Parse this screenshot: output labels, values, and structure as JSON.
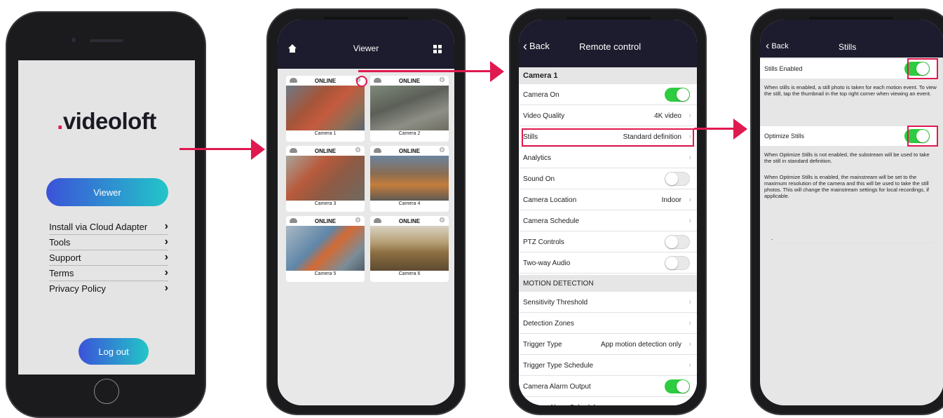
{
  "colors": {
    "accent_red": "#e0194f",
    "toggle_green": "#2ecc40",
    "nav_bar": "#1c1c2e",
    "viewer_gradient": [
      "#3b52d9",
      "#22c6c8"
    ]
  },
  "phone1": {
    "logo_text": "videoloft",
    "viewer_button": "Viewer",
    "menu": [
      {
        "label": "Install via Cloud Adapter",
        "chevron": "›"
      },
      {
        "label": "Tools",
        "chevron": "›"
      },
      {
        "label": "Support",
        "chevron": "›"
      },
      {
        "label": "Terms",
        "chevron": "›"
      },
      {
        "label": "Privacy Policy",
        "chevron": "›"
      }
    ],
    "logout_button": "Log out"
  },
  "phone2": {
    "title": "Viewer",
    "home_icon": "home-icon",
    "grid_icon": "grid-icon",
    "cameras": [
      {
        "status": "ONLINE",
        "name": "Camera 1"
      },
      {
        "status": "ONLINE",
        "name": "Camera 2"
      },
      {
        "status": "ONLINE",
        "name": "Camera 3"
      },
      {
        "status": "ONLINE",
        "name": "Camera 4"
      },
      {
        "status": "ONLINE",
        "name": "Camera 5"
      },
      {
        "status": "ONLINE",
        "name": "Camera 6"
      }
    ]
  },
  "phone3": {
    "back": "Back",
    "title": "Remote control",
    "camera_header": "Camera 1",
    "rows": [
      {
        "label": "Camera On",
        "toggle": true
      },
      {
        "label": "Video Quality",
        "value": "4K video"
      },
      {
        "label": "Stills",
        "value": "Standard definition"
      },
      {
        "label": "Analytics",
        "value": ""
      },
      {
        "label": "Sound On",
        "toggle": false
      },
      {
        "label": "Camera Location",
        "value": "Indoor"
      },
      {
        "label": "Camera Schedule",
        "value": ""
      },
      {
        "label": "PTZ Controls",
        "toggle": false
      },
      {
        "label": "Two-way Audio",
        "toggle": false
      }
    ],
    "motion_section": "MOTION DETECTION",
    "motion_rows": [
      {
        "label": "Sensitivity Threshold",
        "value": ""
      },
      {
        "label": "Detection Zones",
        "value": ""
      },
      {
        "label": "Trigger Type",
        "value": "App motion detection only"
      },
      {
        "label": "Trigger Type Schedule",
        "value": ""
      },
      {
        "label": "Camera Alarm Output",
        "toggle": true
      },
      {
        "label": "Camera Alarm Schedule",
        "value": ""
      }
    ]
  },
  "phone4": {
    "back": "Back",
    "title": "Stills",
    "stills_enabled_label": "Stills Enabled",
    "stills_enabled": true,
    "stills_enabled_desc": "When stills is enabled, a still photo is taken for each motion event. To view the still, tap the thumbnail in the top right corner when viewing an event.",
    "optimize_label": "Optimize Stills",
    "optimize_enabled": true,
    "optimize_desc_1": "When Optimize Stills is not enabled, the substream will be used to take the still in standard definition.",
    "optimize_desc_2": "When Optimize Stills is enabled, the mainstream will be set to the maximum resolution of the camera and this will be used to take the still photos. This will change the mainstream settings for local recordings, if applicable.",
    "stray_dot": "."
  }
}
